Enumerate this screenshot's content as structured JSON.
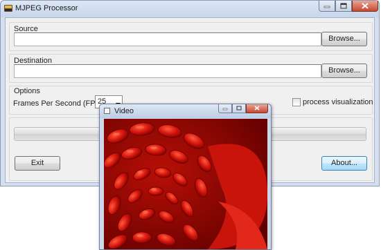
{
  "main_window": {
    "title": "MJPEG Processor",
    "source": {
      "label": "Source",
      "value": "",
      "browse_label": "Browse..."
    },
    "destination": {
      "label": "Destination",
      "value": "",
      "browse_label": "Browse..."
    },
    "options": {
      "label": "Options",
      "fps_label": "Frames Per Second (FPS):",
      "fps_value": "25",
      "process_visualization_label": "process visualization",
      "process_visualization_checked": false
    },
    "progress_fraction": 0,
    "exit_label": "Exit",
    "about_label": "About..."
  },
  "video_window": {
    "title": "Video",
    "frame_colors": {
      "base": "#8a0000",
      "petal": "#d3150d",
      "highlight": "#ff5a3c"
    }
  }
}
